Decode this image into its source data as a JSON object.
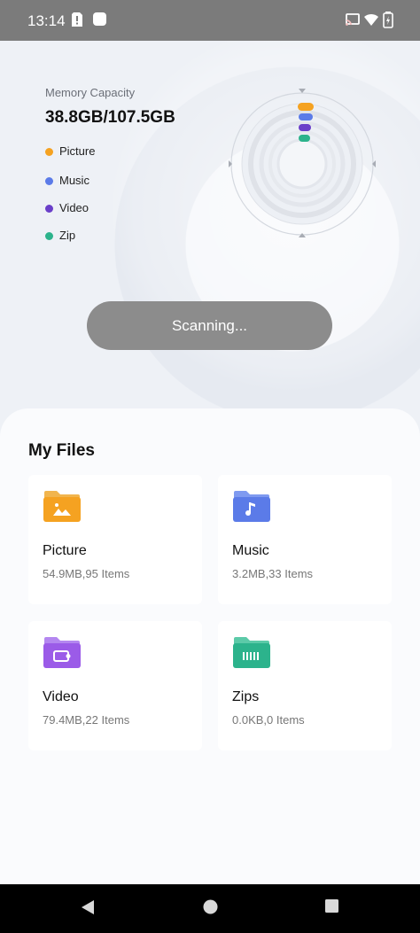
{
  "status_bar": {
    "time": "13:14"
  },
  "memory": {
    "title": "Memory Capacity",
    "value": "38.8GB/107.5GB",
    "legend": [
      {
        "label": "Picture",
        "color": "#f5a221"
      },
      {
        "label": "Music",
        "color": "#5b7be8"
      },
      {
        "label": "Video",
        "color": "#6a3fc9"
      },
      {
        "label": "Zip",
        "color": "#2cb38c"
      }
    ]
  },
  "scan_button": {
    "label": "Scanning..."
  },
  "my_files": {
    "title": "My Files",
    "items": [
      {
        "name": "Picture",
        "meta": "54.9MB,95 Items",
        "icon": "picture-folder-icon",
        "color": "#f5a221"
      },
      {
        "name": "Music",
        "meta": "3.2MB,33 Items",
        "icon": "music-folder-icon",
        "color": "#5b7be8"
      },
      {
        "name": "Video",
        "meta": "79.4MB,22 Items",
        "icon": "video-folder-icon",
        "color": "#9b5be8"
      },
      {
        "name": "Zips",
        "meta": "0.0KB,0 Items",
        "icon": "zip-folder-icon",
        "color": "#2cb38c"
      }
    ]
  },
  "nav_bar": {
    "buttons": [
      "back-icon",
      "home-icon",
      "recents-icon"
    ]
  }
}
